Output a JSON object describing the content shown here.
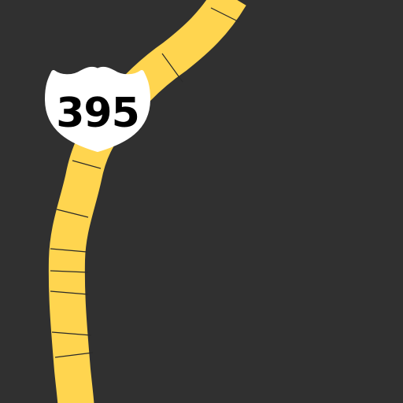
{
  "map": {
    "background_color": "#303030",
    "road_color": "#FFD54F",
    "road_edge_color": "#E0B83C",
    "segment_tick_color": "#2A2A2A"
  },
  "route_shield": {
    "type": "US Route",
    "number": "395",
    "shield_fill": "#FFFFFF",
    "text_color": "#000000",
    "icon": "us-highway-shield-icon"
  }
}
